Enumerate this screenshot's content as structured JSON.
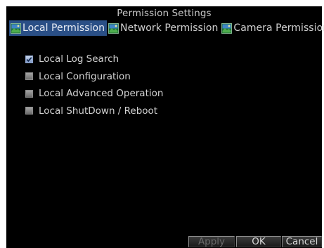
{
  "dialog": {
    "title": "Permission Settings"
  },
  "tabs": [
    {
      "label": "Local Permission",
      "active": true,
      "icon": "camera-view-icon"
    },
    {
      "label": "Network Permission",
      "active": false,
      "icon": "camera-view-icon"
    },
    {
      "label": "Camera Permission",
      "active": false,
      "icon": "camera-view-icon"
    }
  ],
  "permissions": [
    {
      "label": "Local Log Search",
      "checked": true
    },
    {
      "label": "Local Configuration",
      "checked": false
    },
    {
      "label": "Local Advanced Operation",
      "checked": false
    },
    {
      "label": "Local ShutDown / Reboot",
      "checked": false
    }
  ],
  "buttons": {
    "apply": "Apply",
    "ok": "OK",
    "cancel": "Cancel"
  },
  "colors": {
    "background": "#000000",
    "active_tab": "#2a4f86",
    "text": "#cfcfcf",
    "disabled_text": "#6a6a6a"
  }
}
